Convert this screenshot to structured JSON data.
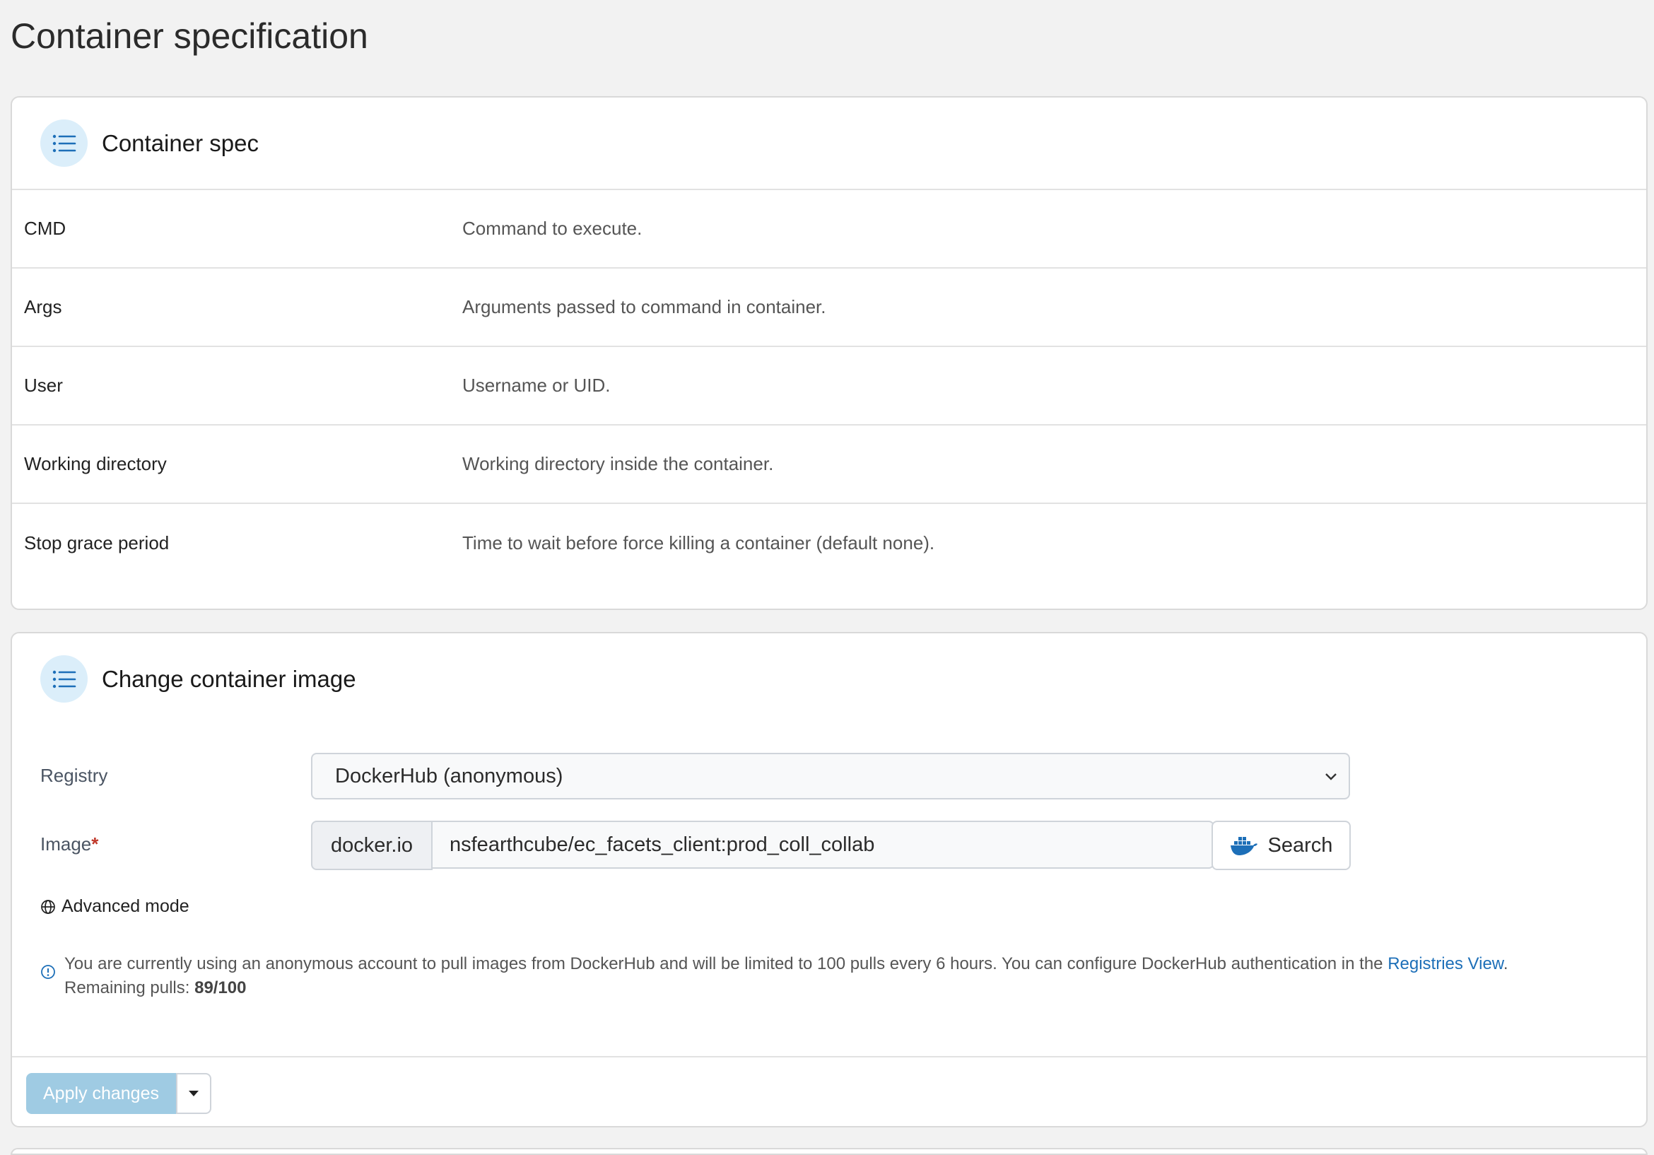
{
  "page": {
    "title": "Container specification"
  },
  "container_spec": {
    "title": "Container spec",
    "rows": [
      {
        "label": "CMD",
        "desc": "Command to execute."
      },
      {
        "label": "Args",
        "desc": "Arguments passed to command in container."
      },
      {
        "label": "User",
        "desc": "Username or UID."
      },
      {
        "label": "Working directory",
        "desc": "Working directory inside the container."
      },
      {
        "label": "Stop grace period",
        "desc": "Time to wait before force killing a container (default none)."
      }
    ]
  },
  "change_image": {
    "title": "Change container image",
    "registry_label": "Registry",
    "registry_value": "DockerHub (anonymous)",
    "image_label": "Image",
    "image_required_mark": "*",
    "image_prefix": "docker.io",
    "image_value": "nsfearthcube/ec_facets_client:prod_coll_collab",
    "search_label": "Search",
    "advanced_mode_label": "Advanced mode",
    "info_text": "You are currently using an anonymous account to pull images from DockerHub and will be limited to 100 pulls every 6 hours. You can configure DockerHub authentication in the ",
    "info_link": "Registries View",
    "info_link_suffix": ".",
    "remaining_label": "Remaining pulls: ",
    "remaining_value": "89/100",
    "apply_label": "Apply changes"
  },
  "colors": {
    "accent": "#1d6fb8",
    "apply_disabled": "#9fcbe3",
    "icon_bg": "#dbeefa"
  }
}
